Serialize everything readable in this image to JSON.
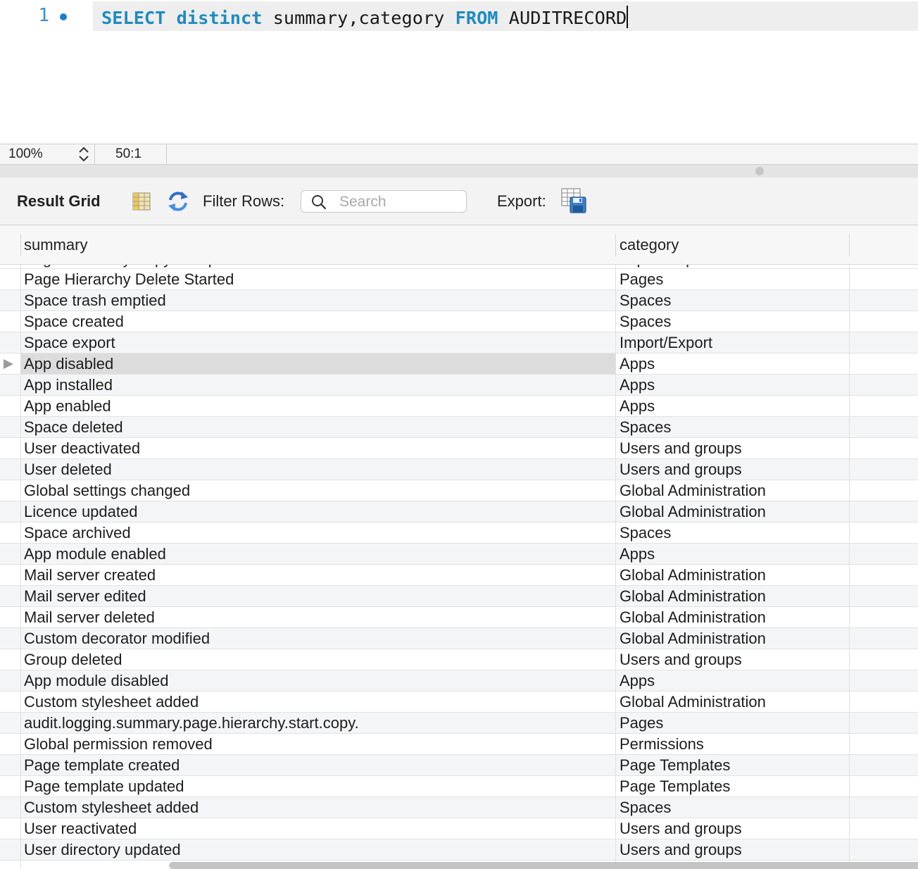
{
  "editor": {
    "line_number": "1",
    "tokens": [
      {
        "text": "SELECT",
        "keyword": true
      },
      {
        "text": " ",
        "keyword": false
      },
      {
        "text": "distinct",
        "keyword": true
      },
      {
        "text": " summary,category ",
        "keyword": false
      },
      {
        "text": "FROM",
        "keyword": true
      },
      {
        "text": " AUDITRECORD",
        "keyword": false
      }
    ]
  },
  "status_bar": {
    "zoom": "100%",
    "cursor_position": "50:1"
  },
  "toolbar": {
    "result_grid_label": "Result Grid",
    "filter_label": "Filter Rows:",
    "search_placeholder": "Search",
    "search_value": "",
    "export_label": "Export:"
  },
  "grid": {
    "columns": [
      "summary",
      "category"
    ],
    "partial_top_row": {
      "summary": "Page Hierarchy Copy Completed",
      "category": "Import/Export"
    },
    "selected_row_index": 4,
    "rows": [
      {
        "summary": "Page Hierarchy Delete Started",
        "category": "Pages"
      },
      {
        "summary": "Space trash emptied",
        "category": "Spaces"
      },
      {
        "summary": "Space created",
        "category": "Spaces"
      },
      {
        "summary": "Space export",
        "category": "Import/Export"
      },
      {
        "summary": "App disabled",
        "category": "Apps"
      },
      {
        "summary": "App installed",
        "category": "Apps"
      },
      {
        "summary": "App enabled",
        "category": "Apps"
      },
      {
        "summary": "Space deleted",
        "category": "Spaces"
      },
      {
        "summary": "User deactivated",
        "category": "Users and groups"
      },
      {
        "summary": "User deleted",
        "category": "Users and groups"
      },
      {
        "summary": "Global settings changed",
        "category": "Global Administration"
      },
      {
        "summary": "Licence updated",
        "category": "Global Administration"
      },
      {
        "summary": "Space archived",
        "category": "Spaces"
      },
      {
        "summary": "App module enabled",
        "category": "Apps"
      },
      {
        "summary": "Mail server created",
        "category": "Global Administration"
      },
      {
        "summary": "Mail server edited",
        "category": "Global Administration"
      },
      {
        "summary": "Mail server deleted",
        "category": "Global Administration"
      },
      {
        "summary": "Custom decorator modified",
        "category": "Global Administration"
      },
      {
        "summary": "Group deleted",
        "category": "Users and groups"
      },
      {
        "summary": "App module disabled",
        "category": "Apps"
      },
      {
        "summary": "Custom stylesheet added",
        "category": "Global Administration"
      },
      {
        "summary": "audit.logging.summary.page.hierarchy.start.copy.",
        "category": "Pages"
      },
      {
        "summary": "Global permission removed",
        "category": "Permissions"
      },
      {
        "summary": "Page template created",
        "category": "Page Templates"
      },
      {
        "summary": "Page template updated",
        "category": "Page Templates"
      },
      {
        "summary": "Custom stylesheet added",
        "category": "Spaces"
      },
      {
        "summary": "User reactivated",
        "category": "Users and groups"
      },
      {
        "summary": "User directory updated",
        "category": "Users and groups"
      }
    ]
  }
}
